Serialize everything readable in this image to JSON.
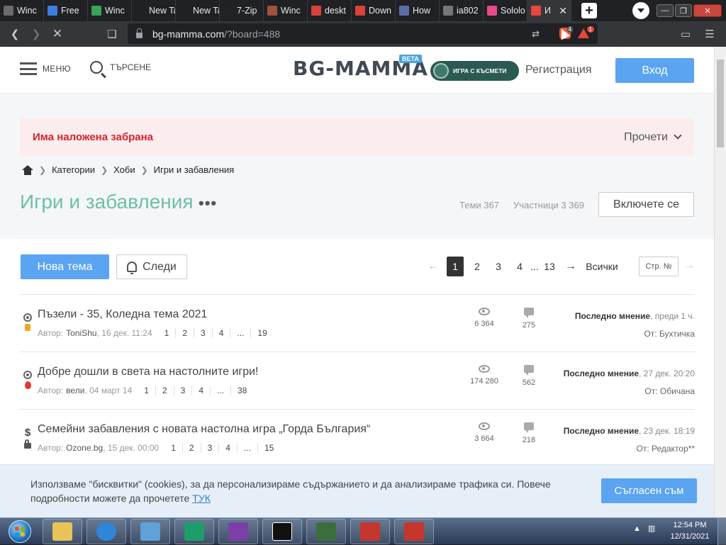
{
  "browser": {
    "tabs": [
      {
        "label": "Winc",
        "color": "#6b6b6b"
      },
      {
        "label": "Free",
        "color": "#3d7de0"
      },
      {
        "label": "Winc",
        "color": "#3aa35a"
      },
      {
        "label": "New Tab",
        "color": ""
      },
      {
        "label": "New Tab",
        "color": ""
      },
      {
        "label": "7-Zip",
        "color": "#222222"
      },
      {
        "label": "Winc",
        "color": "#a0523a"
      },
      {
        "label": "deskt",
        "color": "#d9423a"
      },
      {
        "label": "Down",
        "color": "#d9423a"
      },
      {
        "label": "How",
        "color": "#5b6ea8"
      },
      {
        "label": "ia802",
        "color": "#777777"
      },
      {
        "label": "Sololo",
        "color": "#e84a8a"
      },
      {
        "label": "И",
        "color": "#e8453c",
        "active": true
      }
    ],
    "url_domain": "bg-mamma.com",
    "url_path": "/?board=488",
    "extension_badges": [
      "4",
      "1"
    ]
  },
  "header": {
    "menu_label": "МЕНЮ",
    "search_label": "ТЪРСЕНЕ",
    "logo": "BG-MAMMA",
    "beta": "BETA",
    "lottery": "ИГРА С КЪСМЕТИ",
    "register": "Регистрация",
    "login": "Вход"
  },
  "ban": {
    "text": "Има наложена забрана",
    "read": "Прочети"
  },
  "breadcrumb": [
    "Категории",
    "Хоби",
    "Игри и забавления"
  ],
  "board": {
    "title": "Игри и забавления",
    "more": "•••",
    "topics_stat": "Теми 367",
    "members_stat": "Участници 3 369",
    "join": "Включете се"
  },
  "actions": {
    "new_topic": "Нова тема",
    "follow": "Следи"
  },
  "pagination": {
    "prev": "←",
    "current": "1",
    "pages": [
      "2",
      "3",
      "4"
    ],
    "ellipsis": "...",
    "last": "13",
    "next": "→",
    "all": "Всички",
    "page_box": "Стр. №",
    "end": "→"
  },
  "topics": [
    {
      "title": "Пъзели - 35, Коледна тема 2021",
      "author_label": "Автор:",
      "author": "ToniShu",
      "date": ", 16 дек. 11:24",
      "pages": [
        "1",
        "2",
        "3",
        "4",
        "...",
        "19"
      ],
      "views": "6 364",
      "replies": "275",
      "last_label": "Последно мнение",
      "last_time": ", преди 1 ч.",
      "last_by": "От: Бухтичка",
      "badge": "medal-thumb"
    },
    {
      "title": "Добре дошли в света на настолните игри!",
      "author_label": "Автор:",
      "author": "вели",
      "date": ", 04 март 14",
      "pages": [
        "1",
        "2",
        "3",
        "4",
        "...",
        "38"
      ],
      "views": "174 280",
      "replies": "562",
      "last_label": "Последно мнение",
      "last_time": ", 27 дек. 20:20",
      "last_by": "От: Обичана",
      "badge": "medal-fire"
    },
    {
      "title": "Семейни забавления с новата настолна игра „Горда България“",
      "author_label": "Автор:",
      "author": "Ozone.bg",
      "date": ", 15 дек. 00:00",
      "pages": [
        "1",
        "2",
        "3",
        "4",
        "...",
        "15"
      ],
      "views": "3 664",
      "replies": "218",
      "last_label": "Последно мнение",
      "last_time": ", 23 дек. 18:19",
      "last_by": "От: Редактор**",
      "badge": "dollar-lock"
    }
  ],
  "cookie": {
    "text": "Използваме \"бисквитки\" (cookies), за да персонализираме съдържанието и да анализираме трафика си. Повече подробности можете да прочетете",
    "link": "ТУК",
    "agree": "Съгласен съм"
  },
  "taskbar": {
    "time": "12:54 PM",
    "date": "12/31/2021"
  }
}
